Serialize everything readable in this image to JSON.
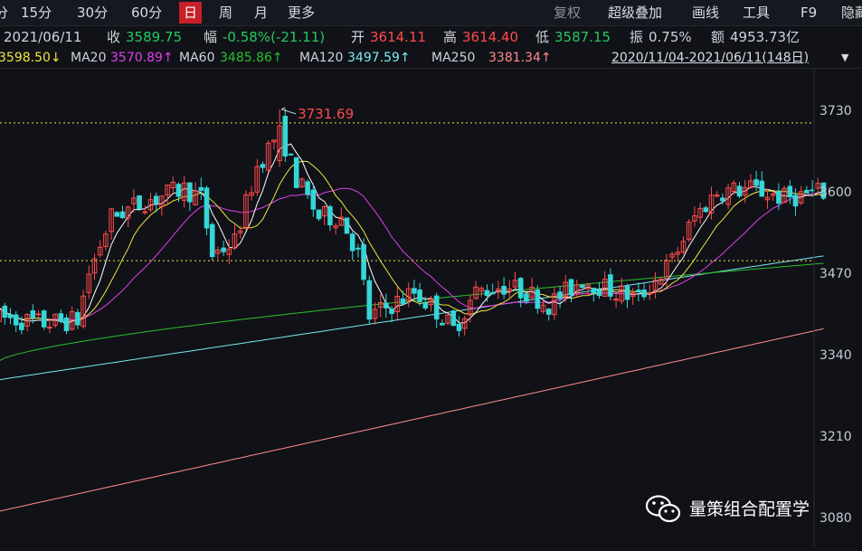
{
  "toolbar": {
    "items": [
      {
        "label": "分",
        "key": "min"
      },
      {
        "label": "15分",
        "key": "m15"
      },
      {
        "label": "30分",
        "key": "m30"
      },
      {
        "label": "60分",
        "key": "m60"
      },
      {
        "label": "日",
        "key": "day",
        "active": true
      },
      {
        "label": "周",
        "key": "week"
      },
      {
        "label": "月",
        "key": "month"
      },
      {
        "label": "更多",
        "key": "more"
      }
    ],
    "right_items": [
      {
        "label": "复权",
        "key": "adjust",
        "dim": true
      },
      {
        "label": "超级叠加",
        "key": "overlay"
      },
      {
        "label": "画线",
        "key": "draw"
      },
      {
        "label": "工具",
        "key": "tools"
      },
      {
        "label": "F9",
        "key": "f9"
      },
      {
        "label": "隐藏",
        "key": "hide"
      }
    ]
  },
  "quote": {
    "date": "2021/06/11",
    "close_label": "收",
    "close": "3589.75",
    "change_label": "幅",
    "change": "-0.58%(-21.11)",
    "open_label": "开",
    "open": "3614.11",
    "high_label": "高",
    "high": "3614.40",
    "low_label": "低",
    "low": "3587.15",
    "amp_label": "振",
    "amp": "0.75%",
    "amount_label": "额",
    "amount": "4953.73亿"
  },
  "ma_line": {
    "ma10_value": "3598.50↓",
    "ma20_label": "MA20",
    "ma20_value": "3570.89↑",
    "ma60_label": "MA60",
    "ma60_value": "3485.86↑",
    "ma120_label": "MA120",
    "ma120_value": "3497.59↑",
    "ma250_label": "MA250",
    "ma250_value": "3381.34↑",
    "range": "2020/11/04-2021/06/11(148日)",
    "range_arrow": "▼"
  },
  "colors": {
    "up": "#ff4a4a",
    "down": "#25c95f",
    "background": "#101218",
    "ma5": "#ffffff",
    "ma10": "#f2e63c",
    "ma20": "#e23ee8",
    "ma60": "#2bbf2b",
    "ma120": "#7be8f0",
    "ma250": "#ff8a8a",
    "volume_up": "#ff4a4a",
    "volume_down": "#35d6d6"
  },
  "chart": {
    "y_ticks": [
      "3730",
      "3600",
      "3470",
      "3340",
      "3210",
      "3080"
    ],
    "y_tick_values": [
      3730,
      3600,
      3470,
      3340,
      3210,
      3080
    ],
    "y_min": 3080,
    "y_max": 3730,
    "high_marker": "3731.69",
    "ref_levels": [
      3710,
      3490
    ],
    "sessions": 148
  },
  "watermark": {
    "icon": "wechat-icon",
    "text": "量策组合配置学"
  }
}
